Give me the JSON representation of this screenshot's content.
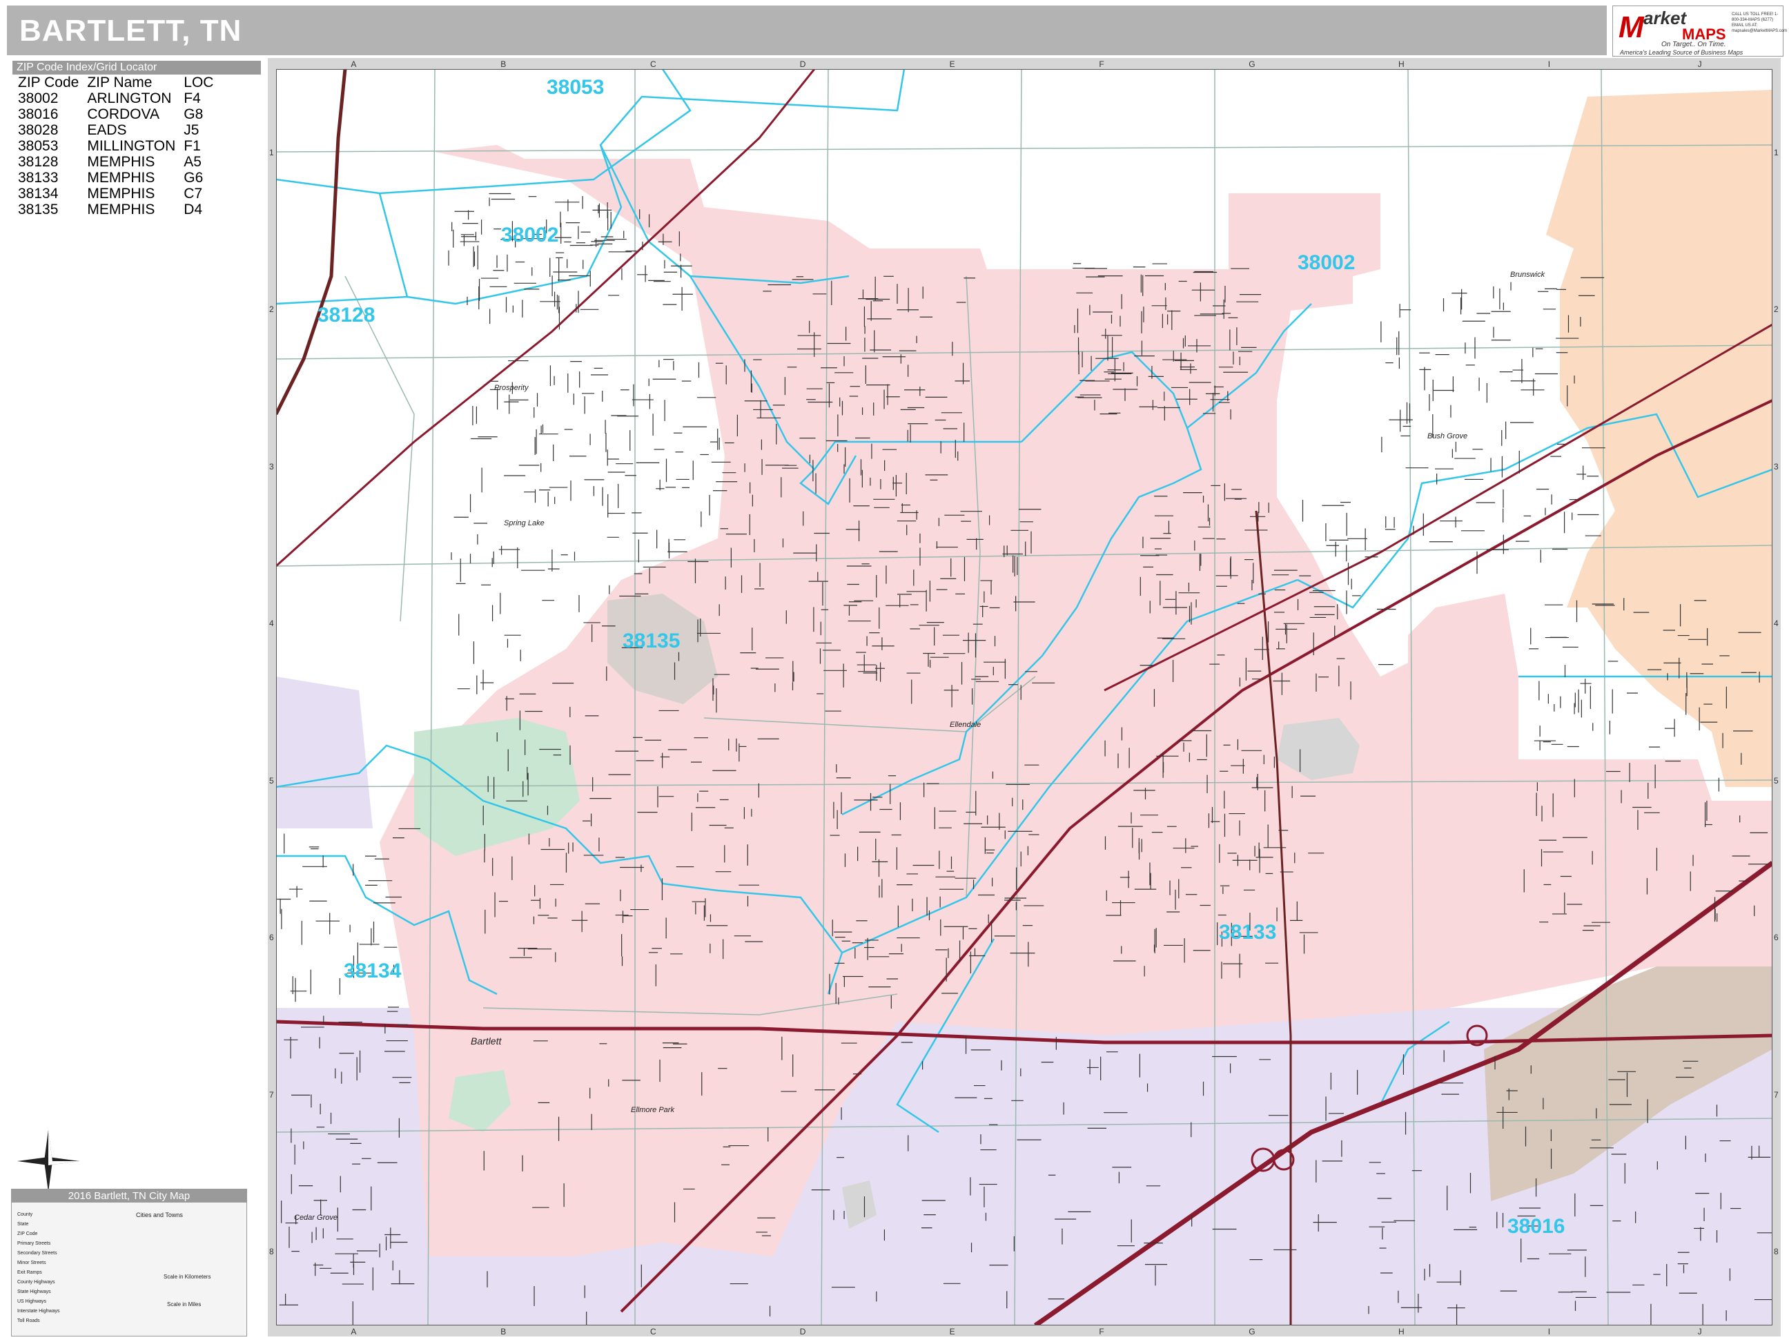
{
  "title": "BARTLETT, TN",
  "logo": {
    "brand_line1": "arket",
    "brand_line2": "MAPS",
    "tagline": "On Target.. On Time.",
    "tagline2": "America's Leading Source of Business Maps",
    "contact": "CALL US TOLL FREE! 1-800-334-MAPS (6277)  EMAIL US AT: mapsales@MarketMAPS.com"
  },
  "zip_index": {
    "header": "ZIP Code Index/Grid Locator",
    "columns": [
      "ZIP Code",
      "ZIP Name",
      "LOC"
    ],
    "rows": [
      [
        "38002",
        "ARLINGTON",
        "F4"
      ],
      [
        "38016",
        "CORDOVA",
        "G8"
      ],
      [
        "38028",
        "EADS",
        "J5"
      ],
      [
        "38053",
        "MILLINGTON",
        "F1"
      ],
      [
        "38128",
        "MEMPHIS",
        "A5"
      ],
      [
        "38133",
        "MEMPHIS",
        "G6"
      ],
      [
        "38134",
        "MEMPHIS",
        "C7"
      ],
      [
        "38135",
        "MEMPHIS",
        "D4"
      ]
    ]
  },
  "grid": {
    "columns": [
      "A",
      "B",
      "C",
      "D",
      "E",
      "F",
      "G",
      "H",
      "I",
      "J"
    ],
    "rows": [
      "1",
      "2",
      "3",
      "4",
      "5",
      "6",
      "7",
      "8"
    ]
  },
  "zip_labels": [
    {
      "text": "38053"
    },
    {
      "text": "38002"
    },
    {
      "text": "38128"
    },
    {
      "text": "38002"
    },
    {
      "text": "38135"
    },
    {
      "text": "38133"
    },
    {
      "text": "38134"
    },
    {
      "text": "38016"
    }
  ],
  "places": [
    "Prosperity",
    "Spring Lake",
    "Ellendale",
    "Bartlett",
    "Ellmore Park",
    "Cedar Grove",
    "Brunswick",
    "Bush Grove"
  ],
  "legend": {
    "title": "2016 Bartlett, TN City Map",
    "items": [
      "County",
      "State",
      "ZIP Code",
      "Primary Streets",
      "Secondary Streets",
      "Minor Streets",
      "Exit Ramps",
      "County Highways",
      "State Highways",
      "US Highways",
      "Interstate Highways",
      "Toll Roads"
    ],
    "cities_title": "Cities and Towns",
    "scale_km": "Scale in Kilometers",
    "scale_mi": "Scale in Miles"
  },
  "colors": {
    "city_pink": "#f9d9dc",
    "memphis_lavender": "#e6dff4",
    "arlington_orange": "#fbdcc3",
    "park_green": "#c9e6d2",
    "zip_boundary": "#34c6e8",
    "highway": "#8b1a2e"
  }
}
